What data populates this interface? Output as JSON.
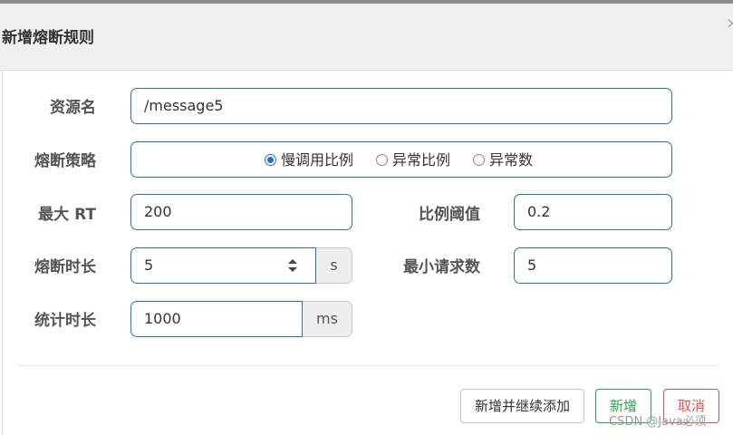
{
  "dialog": {
    "title": "新增熔断规则",
    "close_glyph": "×"
  },
  "form": {
    "resource_name": {
      "label": "资源名",
      "value": "/message5"
    },
    "strategy": {
      "label": "熔断策略",
      "options": [
        {
          "label": "慢调用比例",
          "checked": true
        },
        {
          "label": "异常比例",
          "checked": false
        },
        {
          "label": "异常数",
          "checked": false
        }
      ]
    },
    "max_rt": {
      "label": "最大 RT",
      "value": "200"
    },
    "ratio_threshold": {
      "label": "比例阈值",
      "value": "0.2"
    },
    "break_duration": {
      "label": "熔断时长",
      "value": "5",
      "unit": "s"
    },
    "min_requests": {
      "label": "最小请求数",
      "value": "5"
    },
    "stat_duration": {
      "label": "统计时长",
      "value": "1000",
      "unit": "ms"
    }
  },
  "footer": {
    "add_continue_label": "新增并继续添加",
    "add_label": "新增",
    "cancel_label": "取消"
  },
  "watermark": "CSDN @Java必须",
  "icons": {
    "close": "close-icon",
    "spinner": "spinner-arrows-icon",
    "radio": "radio-icon"
  }
}
